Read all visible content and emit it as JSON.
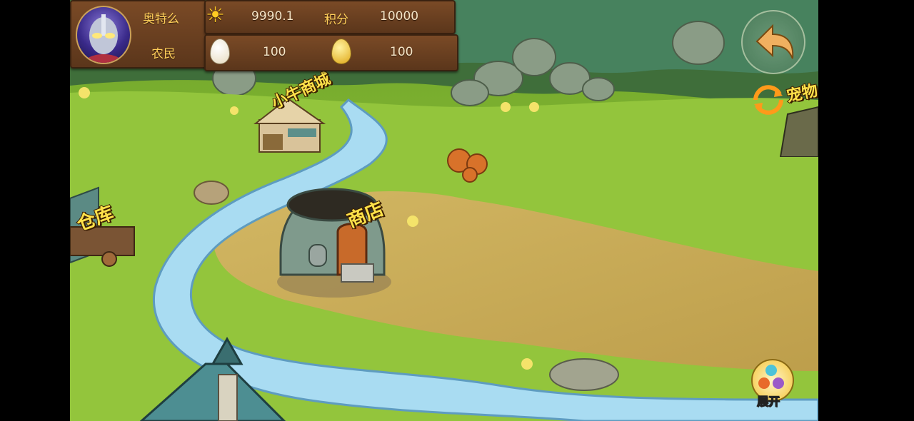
{
  "player": {
    "name": "奥特么",
    "title": "农民"
  },
  "resources": {
    "sun_value": "9990.1",
    "score_label": "积分",
    "score_value": "10000",
    "egg_white_value": "100",
    "egg_gold_value": "100"
  },
  "buildings": {
    "mall_label": "小牛商城",
    "shop_label": "商店",
    "warehouse_label": "仓库",
    "pets_label": "宠物"
  },
  "buttons": {
    "expand_label": "展开"
  },
  "colors": {
    "grass": "#8cc63a",
    "river": "#9fd4ef",
    "plank": "#6a3f20",
    "label_yellow": "#ffe24a"
  }
}
